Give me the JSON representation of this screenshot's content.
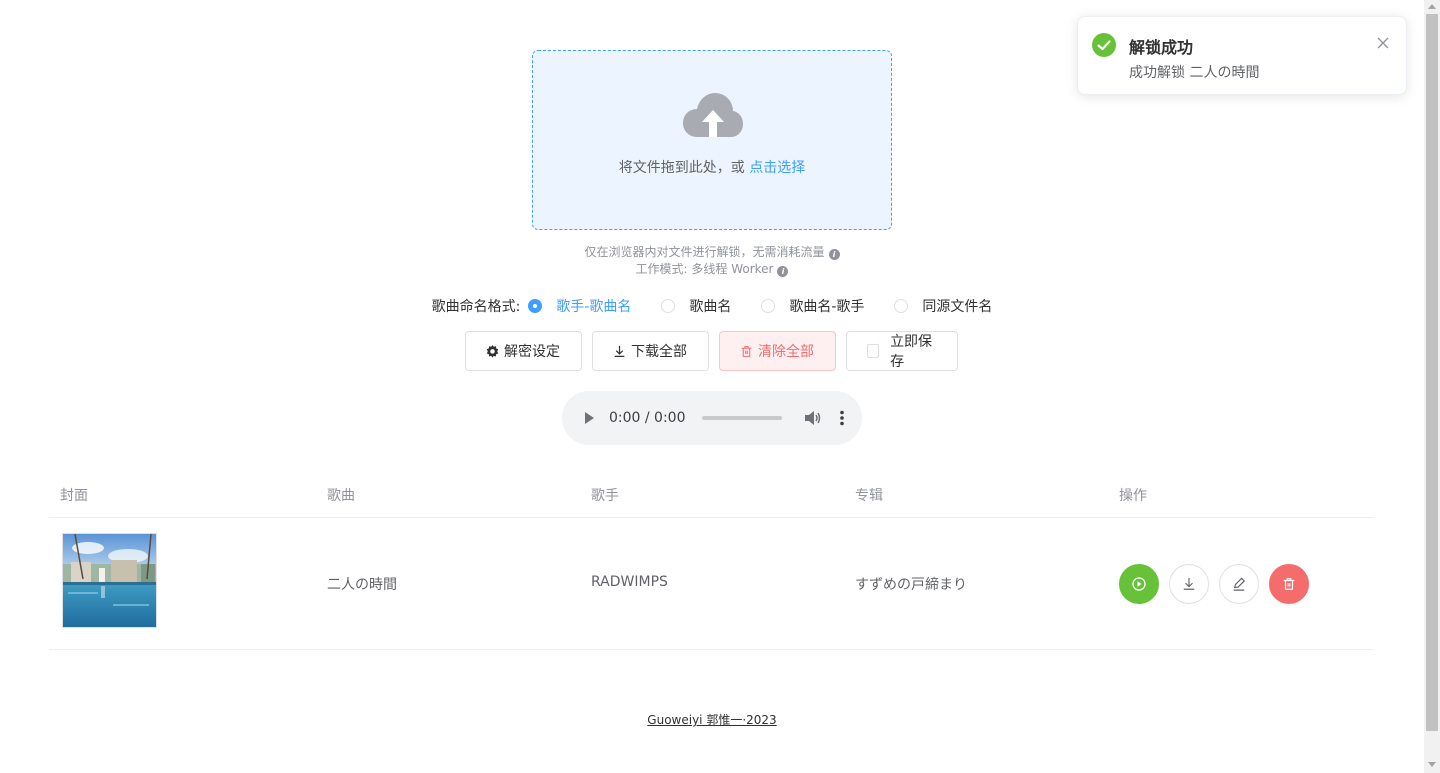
{
  "upload": {
    "text": "将文件拖到此处，或",
    "link": "点击选择"
  },
  "tips": {
    "line1": "仅在浏览器内对文件进行解锁，无需消耗流量",
    "line2": "工作模式: 多线程 Worker"
  },
  "naming": {
    "label": "歌曲命名格式:",
    "options": [
      "歌手-歌曲名",
      "歌曲名",
      "歌曲名-歌手",
      "同源文件名"
    ],
    "selected_index": 0
  },
  "toolbar": {
    "settings_label": "解密设定",
    "download_all_label": "下载全部",
    "clear_all_label": "清除全部",
    "save_now_label": "立即保存"
  },
  "player": {
    "time": "0:00 / 0:00"
  },
  "table": {
    "headers": {
      "cover": "封面",
      "song": "歌曲",
      "artist": "歌手",
      "album": "专辑",
      "actions": "操作"
    },
    "rows": [
      {
        "title": "二人の時間",
        "artist": "RADWIMPS",
        "album": "すずめの戸締まり"
      }
    ]
  },
  "footer": {
    "text": "Guoweiyi 郭惟一·2023"
  },
  "notification": {
    "title": "解锁成功",
    "message": "成功解锁 二人の時間"
  },
  "colors": {
    "primary": "#409eff",
    "success": "#67c23a",
    "danger": "#f56c6c"
  },
  "icons": [
    "upload-cloud-icon",
    "info-icon",
    "gear-icon",
    "download-icon",
    "trash-icon",
    "play-icon",
    "volume-icon",
    "more-vertical-icon",
    "play-circle-icon",
    "edit-icon",
    "success-check-icon",
    "close-icon"
  ]
}
